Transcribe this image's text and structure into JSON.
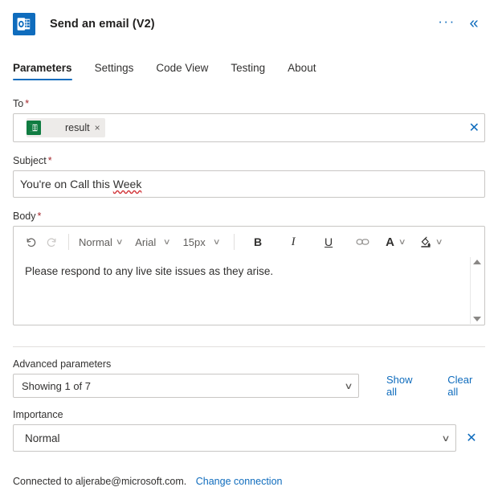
{
  "header": {
    "title": "Send an email (V2)",
    "app_icon": "outlook-icon",
    "icon_color": "#0F6CBD",
    "more_label": "···",
    "collapse_label": "«"
  },
  "tabs": [
    {
      "label": "Parameters",
      "active": true
    },
    {
      "label": "Settings",
      "active": false
    },
    {
      "label": "Code View",
      "active": false
    },
    {
      "label": "Testing",
      "active": false
    },
    {
      "label": "About",
      "active": false
    }
  ],
  "fields": {
    "to": {
      "label": "To",
      "required_marker": "*",
      "token": {
        "icon": "excel-icon",
        "icon_color": "#107C41",
        "label": "result",
        "remove_label": "×"
      },
      "clear_label": "✕"
    },
    "subject": {
      "label": "Subject",
      "required_marker": "*",
      "value_prefix": "You're on Call this ",
      "value_misspelled": "Week"
    },
    "body": {
      "label": "Body",
      "required_marker": "*",
      "content": "Please respond to any live site issues as they arise.",
      "toolbar": {
        "undo": "↺",
        "redo": "↻",
        "style": "Normal",
        "font": "Arial",
        "size": "15px",
        "bold": "B",
        "italic": "I",
        "underline": "U",
        "link": "∞",
        "font_color": "A",
        "highlight": "✐",
        "chevron": "∨"
      },
      "scroll_up": "scroll-up-arrow",
      "scroll_down": "scroll-down-arrow"
    },
    "advanced": {
      "label": "Advanced parameters",
      "selected": "Showing 1 of 7",
      "show_all": "Show all",
      "clear_all": "Clear all"
    },
    "importance": {
      "label": "Importance",
      "selected": "Normal",
      "clear_label": "✕"
    }
  },
  "footer": {
    "connection_text": "Connected to aljerabe@microsoft.com.",
    "change_link": "Change connection"
  },
  "colors": {
    "accent": "#0F6CBD",
    "required": "#a4262c",
    "excel_green": "#107C41",
    "spellcheck": "#d13438"
  }
}
